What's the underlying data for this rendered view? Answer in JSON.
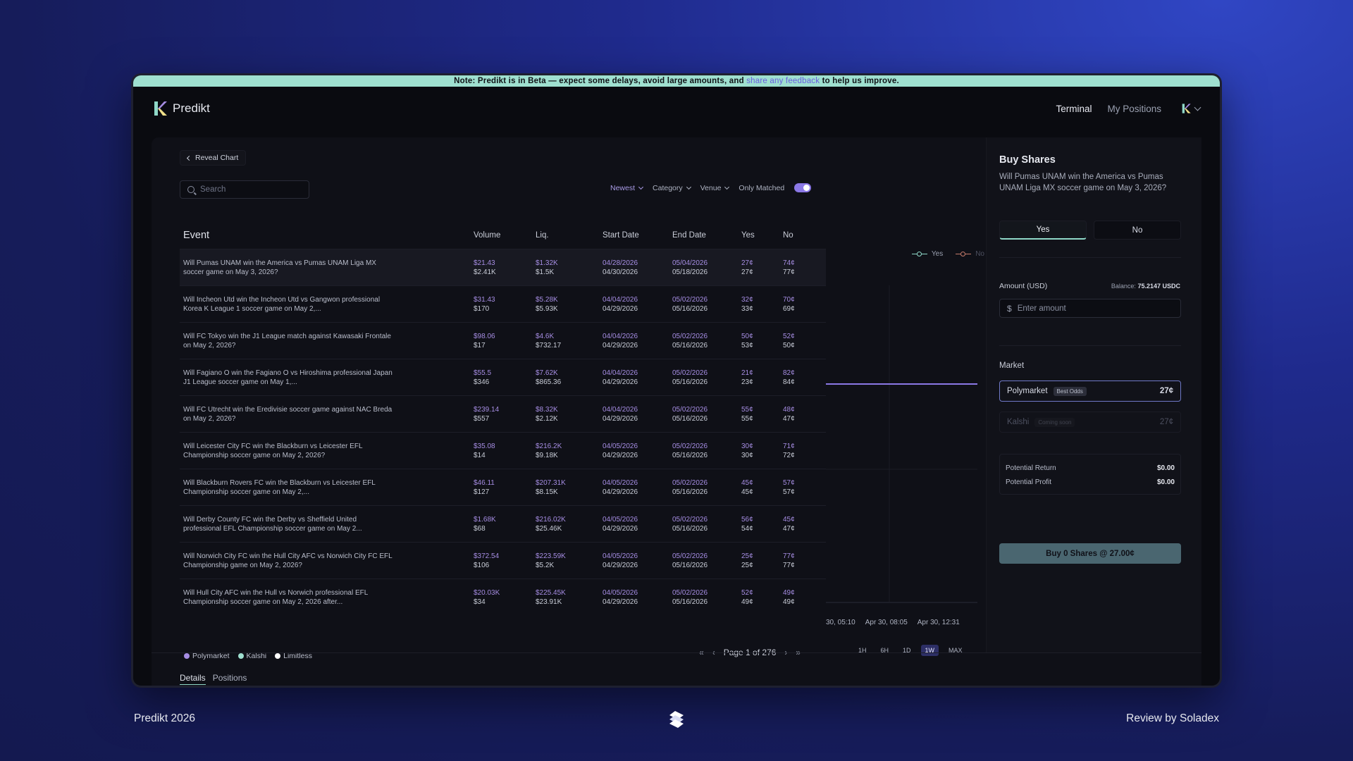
{
  "banner": {
    "prefix": "Note: Predikt is in Beta — expect some delays, avoid large amounts, and ",
    "link": "share any feedback",
    "suffix": " to help us improve."
  },
  "nav": {
    "brand": "Predikt",
    "links": [
      "Terminal",
      "My Positions"
    ]
  },
  "toolbar": {
    "reveal_chart": "Reveal Chart",
    "search_placeholder": "Search",
    "sort": "Newest",
    "category": "Category",
    "venue": "Venue",
    "only_matched": "Only Matched",
    "only_matched_on": true
  },
  "table": {
    "headers": [
      "Event",
      "Volume",
      "Liq.",
      "Start Date",
      "End Date",
      "Yes",
      "No"
    ],
    "rows": [
      {
        "event": "Will Pumas UNAM win the America vs Pumas UNAM Liga MX soccer game on May 3, 2026?",
        "vol": [
          "$21.43",
          "$2.41K"
        ],
        "liq": [
          "$1.32K",
          "$1.5K"
        ],
        "start": [
          "04/28/2026",
          "04/30/2026"
        ],
        "end": [
          "05/04/2026",
          "05/18/2026"
        ],
        "yes": [
          "27¢",
          "27¢"
        ],
        "no": [
          "74¢",
          "77¢"
        ]
      },
      {
        "event": "Will Incheon Utd win the Incheon Utd vs Gangwon professional Korea K League 1 soccer game on May 2,...",
        "vol": [
          "$31.43",
          "$170"
        ],
        "liq": [
          "$5.28K",
          "$5.93K"
        ],
        "start": [
          "04/04/2026",
          "04/29/2026"
        ],
        "end": [
          "05/02/2026",
          "05/16/2026"
        ],
        "yes": [
          "32¢",
          "33¢"
        ],
        "no": [
          "70¢",
          "69¢"
        ]
      },
      {
        "event": "Will FC Tokyo win the J1 League match against Kawasaki Frontale on May 2, 2026?",
        "vol": [
          "$98.06",
          "$17"
        ],
        "liq": [
          "$4.6K",
          "$732.17"
        ],
        "start": [
          "04/04/2026",
          "04/29/2026"
        ],
        "end": [
          "05/02/2026",
          "05/16/2026"
        ],
        "yes": [
          "50¢",
          "53¢"
        ],
        "no": [
          "52¢",
          "50¢"
        ]
      },
      {
        "event": "Will Fagiano O win the Fagiano O vs Hiroshima professional Japan J1 League soccer game on May 1,...",
        "vol": [
          "$55.5",
          "$346"
        ],
        "liq": [
          "$7.62K",
          "$865.36"
        ],
        "start": [
          "04/04/2026",
          "04/29/2026"
        ],
        "end": [
          "05/02/2026",
          "05/16/2026"
        ],
        "yes": [
          "21¢",
          "23¢"
        ],
        "no": [
          "82¢",
          "84¢"
        ]
      },
      {
        "event": "Will FC Utrecht win the Eredivisie soccer game against NAC Breda on May 2, 2026?",
        "vol": [
          "$239.14",
          "$557"
        ],
        "liq": [
          "$8.32K",
          "$2.12K"
        ],
        "start": [
          "04/04/2026",
          "04/29/2026"
        ],
        "end": [
          "05/02/2026",
          "05/16/2026"
        ],
        "yes": [
          "55¢",
          "55¢"
        ],
        "no": [
          "48¢",
          "47¢"
        ]
      },
      {
        "event": "Will Leicester City FC win the Blackburn vs Leicester EFL Championship soccer game on May 2, 2026?",
        "vol": [
          "$35.08",
          "$14"
        ],
        "liq": [
          "$216.2K",
          "$9.18K"
        ],
        "start": [
          "04/05/2026",
          "04/29/2026"
        ],
        "end": [
          "05/02/2026",
          "05/16/2026"
        ],
        "yes": [
          "30¢",
          "30¢"
        ],
        "no": [
          "71¢",
          "72¢"
        ]
      },
      {
        "event": "Will Blackburn Rovers FC win the Blackburn vs Leicester EFL Championship soccer game on May 2,...",
        "vol": [
          "$46.11",
          "$127"
        ],
        "liq": [
          "$207.31K",
          "$8.15K"
        ],
        "start": [
          "04/05/2026",
          "04/29/2026"
        ],
        "end": [
          "05/02/2026",
          "05/16/2026"
        ],
        "yes": [
          "45¢",
          "45¢"
        ],
        "no": [
          "57¢",
          "57¢"
        ]
      },
      {
        "event": "Will Derby County FC win the Derby vs Sheffield United professional EFL Championship soccer game on May 2...",
        "vol": [
          "$1.68K",
          "$68"
        ],
        "liq": [
          "$216.02K",
          "$25.46K"
        ],
        "start": [
          "04/05/2026",
          "04/29/2026"
        ],
        "end": [
          "05/02/2026",
          "05/16/2026"
        ],
        "yes": [
          "56¢",
          "54¢"
        ],
        "no": [
          "45¢",
          "47¢"
        ]
      },
      {
        "event": "Will Norwich City FC win the Hull City AFC vs Norwich City FC EFL Championship game on May 2, 2026?",
        "vol": [
          "$372.54",
          "$106"
        ],
        "liq": [
          "$223.59K",
          "$5.2K"
        ],
        "start": [
          "04/05/2026",
          "04/29/2026"
        ],
        "end": [
          "05/02/2026",
          "05/16/2026"
        ],
        "yes": [
          "25¢",
          "25¢"
        ],
        "no": [
          "77¢",
          "77¢"
        ]
      },
      {
        "event": "Will Hull City AFC win the Hull vs Norwich professional EFL Championship soccer game on May 2, 2026 after...",
        "vol": [
          "$20.03K",
          "$34"
        ],
        "liq": [
          "$225.45K",
          "$23.91K"
        ],
        "start": [
          "04/05/2026",
          "04/29/2026"
        ],
        "end": [
          "05/02/2026",
          "05/16/2026"
        ],
        "yes": [
          "52¢",
          "49¢"
        ],
        "no": [
          "49¢",
          "49¢"
        ]
      }
    ]
  },
  "legend": [
    "Polymarket",
    "Kalshi",
    "Limitless"
  ],
  "pager": {
    "label": "Page 1 of 276"
  },
  "chart": {
    "legend_yes": "Yes",
    "legend_no": "No",
    "x_ticks": [
      "30, 05:10",
      "Apr 30, 08:05",
      "Apr 30, 12:31"
    ],
    "timeframes": [
      "1H",
      "6H",
      "1D",
      "1W",
      "MAX"
    ],
    "active_timeframe": "1W"
  },
  "bottom_tabs": [
    "Details",
    "Positions"
  ],
  "buy": {
    "title": "Buy Shares",
    "question": "Will Pumas UNAM win the America vs Pumas UNAM Liga MX soccer game on May 3, 2026?",
    "yes": "Yes",
    "no": "No",
    "amount_label": "Amount (USD)",
    "balance_label": "Balance:",
    "balance_value": "75.2147 USDC",
    "amount_placeholder": "Enter amount",
    "market_label": "Market",
    "markets": [
      {
        "name": "Polymarket",
        "badge": "Best Odds",
        "price": "27¢"
      },
      {
        "name": "Kalshi",
        "badge": "Coming soon",
        "price": "27¢"
      }
    ],
    "potential_return_label": "Potential Return",
    "potential_return": "$0.00",
    "potential_profit_label": "Potential Profit",
    "potential_profit": "$0.00",
    "buy_button": "Buy 0 Shares @ 27.00¢"
  },
  "footer": {
    "left": "Predikt 2026",
    "right": "Review by Soladex"
  },
  "colors": {
    "accent": "#8b78e6",
    "polymarket": "#a68de3",
    "teal": "#8fd8c8"
  }
}
